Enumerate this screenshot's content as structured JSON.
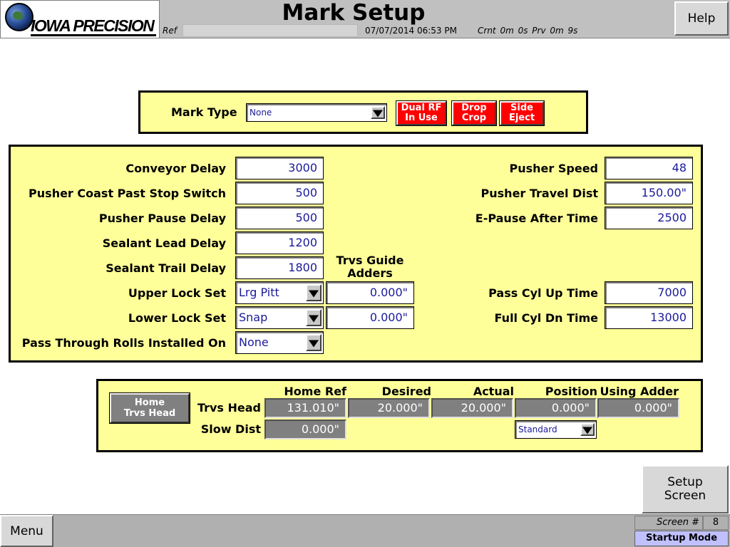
{
  "header": {
    "logo_text": "IOWA PRECISION",
    "title": "Mark Setup",
    "ref_label": "Ref",
    "datetime": "07/07/2014 06:53 PM",
    "status_text": "Crnt  0m  0s Prv  0m 9s",
    "help_label": "Help"
  },
  "mark_type": {
    "label": "Mark Type",
    "selected": "None",
    "buttons": [
      {
        "line1": "Dual RF",
        "line2": "In Use"
      },
      {
        "line1": "Drop",
        "line2": "Crop"
      },
      {
        "line1": "Side",
        "line2": "Eject"
      }
    ]
  },
  "main": {
    "left_rows": [
      {
        "label": "Conveyor Delay",
        "value": "3000"
      },
      {
        "label": "Pusher Coast Past Stop Switch",
        "value": "500"
      },
      {
        "label": "Pusher Pause Delay",
        "value": "500"
      },
      {
        "label": "Sealant Lead Delay",
        "value": "1200"
      },
      {
        "label": "Sealant Trail Delay",
        "value": "1800"
      }
    ],
    "trvs_guide_header": {
      "line1": "Trvs Guide",
      "line2": "Adders"
    },
    "upper_lock": {
      "label": "Upper Lock Set",
      "selected": "Lrg Pitt",
      "adder": "0.000\""
    },
    "lower_lock": {
      "label": "Lower Lock Set",
      "selected": "Snap",
      "adder": "0.000\""
    },
    "pass_through": {
      "label": "Pass Through Rolls Installed On",
      "selected": "None"
    },
    "right_rows": [
      {
        "label": "Pusher Speed",
        "value": "48"
      },
      {
        "label": "Pusher Travel Dist",
        "value": "150.00\""
      },
      {
        "label": "E-Pause After Time",
        "value": "2500"
      }
    ],
    "right_rows_lower": [
      {
        "label": "Pass Cyl Up Time",
        "value": "7000"
      },
      {
        "label": "Full Cyl Dn Time",
        "value": "13000"
      }
    ]
  },
  "trvs": {
    "home_button": {
      "line1": "Home",
      "line2": "Trvs Head"
    },
    "columns": [
      "Home Ref",
      "Desired",
      "Actual",
      "Position",
      "Using Adder"
    ],
    "head_label": "Trvs Head",
    "head_values": [
      "131.010\"",
      "20.000\"",
      "20.000\"",
      "0.000\"",
      "0.000\""
    ],
    "slow_label": "Slow Dist",
    "slow_value": "0.000\"",
    "mode_selected": "Standard"
  },
  "footer": {
    "setup_line1": "Setup",
    "setup_line2": "Screen",
    "menu_label": "Menu",
    "screen_label": "Screen #",
    "screen_number": "8",
    "mode": "Startup Mode"
  },
  "colors": {
    "panel_yellow": "#ffff99",
    "alert_red": "#ff0000",
    "value_blue": "#1a1a9a",
    "readonly_gray": "#808080"
  }
}
